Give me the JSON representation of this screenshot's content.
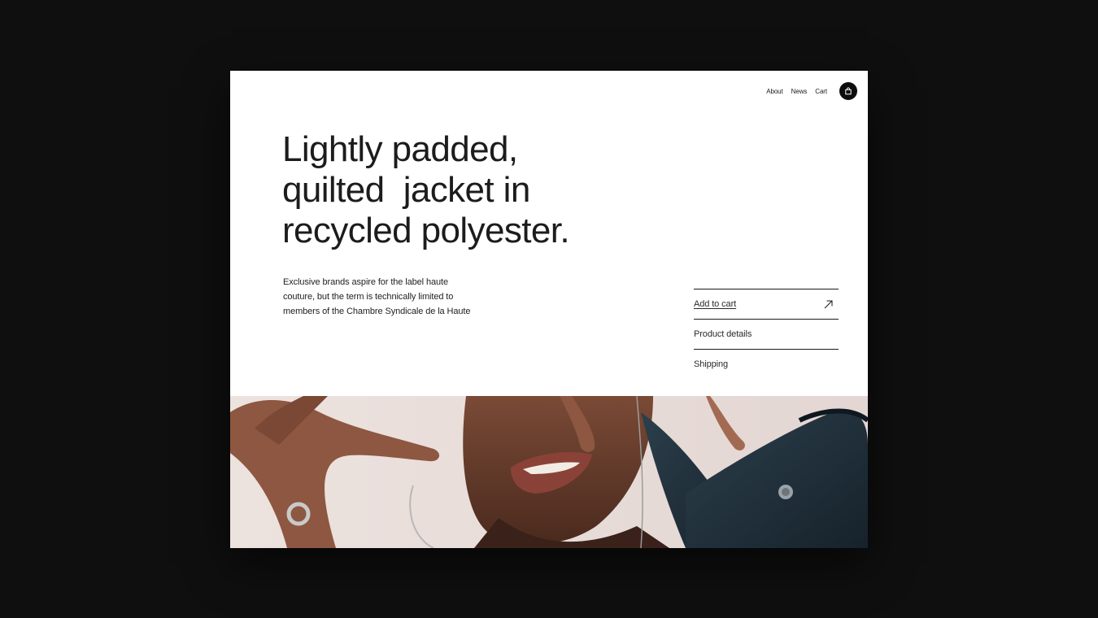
{
  "nav": {
    "items": [
      "About",
      "News",
      "Cart"
    ]
  },
  "hero": {
    "headline": [
      "Lightly padded,",
      "quilted  jacket in",
      "recycled polyester."
    ],
    "description": [
      "Exclusive brands aspire for the label haute",
      "couture, but the term is technically limited to",
      "members of the Chambre Syndicale de la Haute"
    ]
  },
  "actions": {
    "add_to_cart": "Add to cart",
    "product_details": "Product details",
    "shipping": "Shipping"
  },
  "icons": {
    "cart": "shopping-bag-icon",
    "add_to_cart": "arrow-up-right-icon"
  },
  "colors": {
    "background": "#0f0f0f",
    "page": "#ffffff",
    "text": "#1c1c1c",
    "cart_button": "#0d0d0d"
  }
}
